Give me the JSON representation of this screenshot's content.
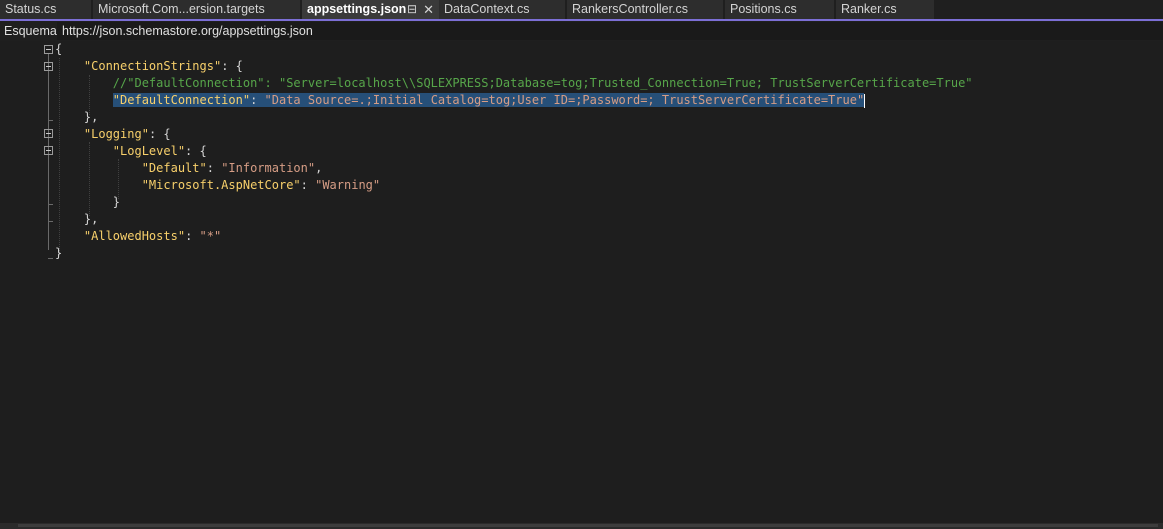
{
  "tabs": [
    {
      "label": "Status.cs"
    },
    {
      "label": "Microsoft.Com...ersion.targets"
    },
    {
      "label": "appsettings.json",
      "active": true
    },
    {
      "label": "DataContext.cs"
    },
    {
      "label": "RankersController.cs"
    },
    {
      "label": "Positions.cs"
    },
    {
      "label": "Ranker.cs"
    }
  ],
  "tab_icons": {
    "pin": "pin-icon",
    "close": "close-icon"
  },
  "schema": {
    "label": "Esquema:",
    "value": "https://json.schemastore.org/appsettings.json"
  },
  "code": {
    "l1_open": "{",
    "l2_key": "\"ConnectionStrings\"",
    "l2_rest": ": {",
    "l3_comment": "//\"DefaultConnection\": \"Server=localhost\\\\SQLEXPRESS;Database=tog;Trusted_Connection=True; TrustServerCertificate=True\"",
    "l4_key": "\"DefaultConnection\"",
    "l4_colon": ": ",
    "l4_value": "\"Data Source=.;Initial Catalog=tog;User ID=;Password=; TrustServerCertificate=True\"",
    "l5_close": "},",
    "l6_key": "\"Logging\"",
    "l6_rest": ": {",
    "l7_key": "\"LogLevel\"",
    "l7_rest": ": {",
    "l8_key": "\"Default\"",
    "l8_colon": ": ",
    "l8_value": "\"Information\"",
    "l8_comma": ",",
    "l9_key": "\"Microsoft.AspNetCore\"",
    "l9_colon": ": ",
    "l9_value": "\"Warning\"",
    "l10_close": "}",
    "l11_close": "},",
    "l12_key": "\"AllowedHosts\"",
    "l12_colon": ": ",
    "l12_value": "\"*\"",
    "l13_close": "}"
  },
  "colors": {
    "accent": "#7c6fd6",
    "key": "#f8d06b",
    "string": "#d69d85",
    "comment": "#57a64a",
    "selection": "#264f78"
  }
}
